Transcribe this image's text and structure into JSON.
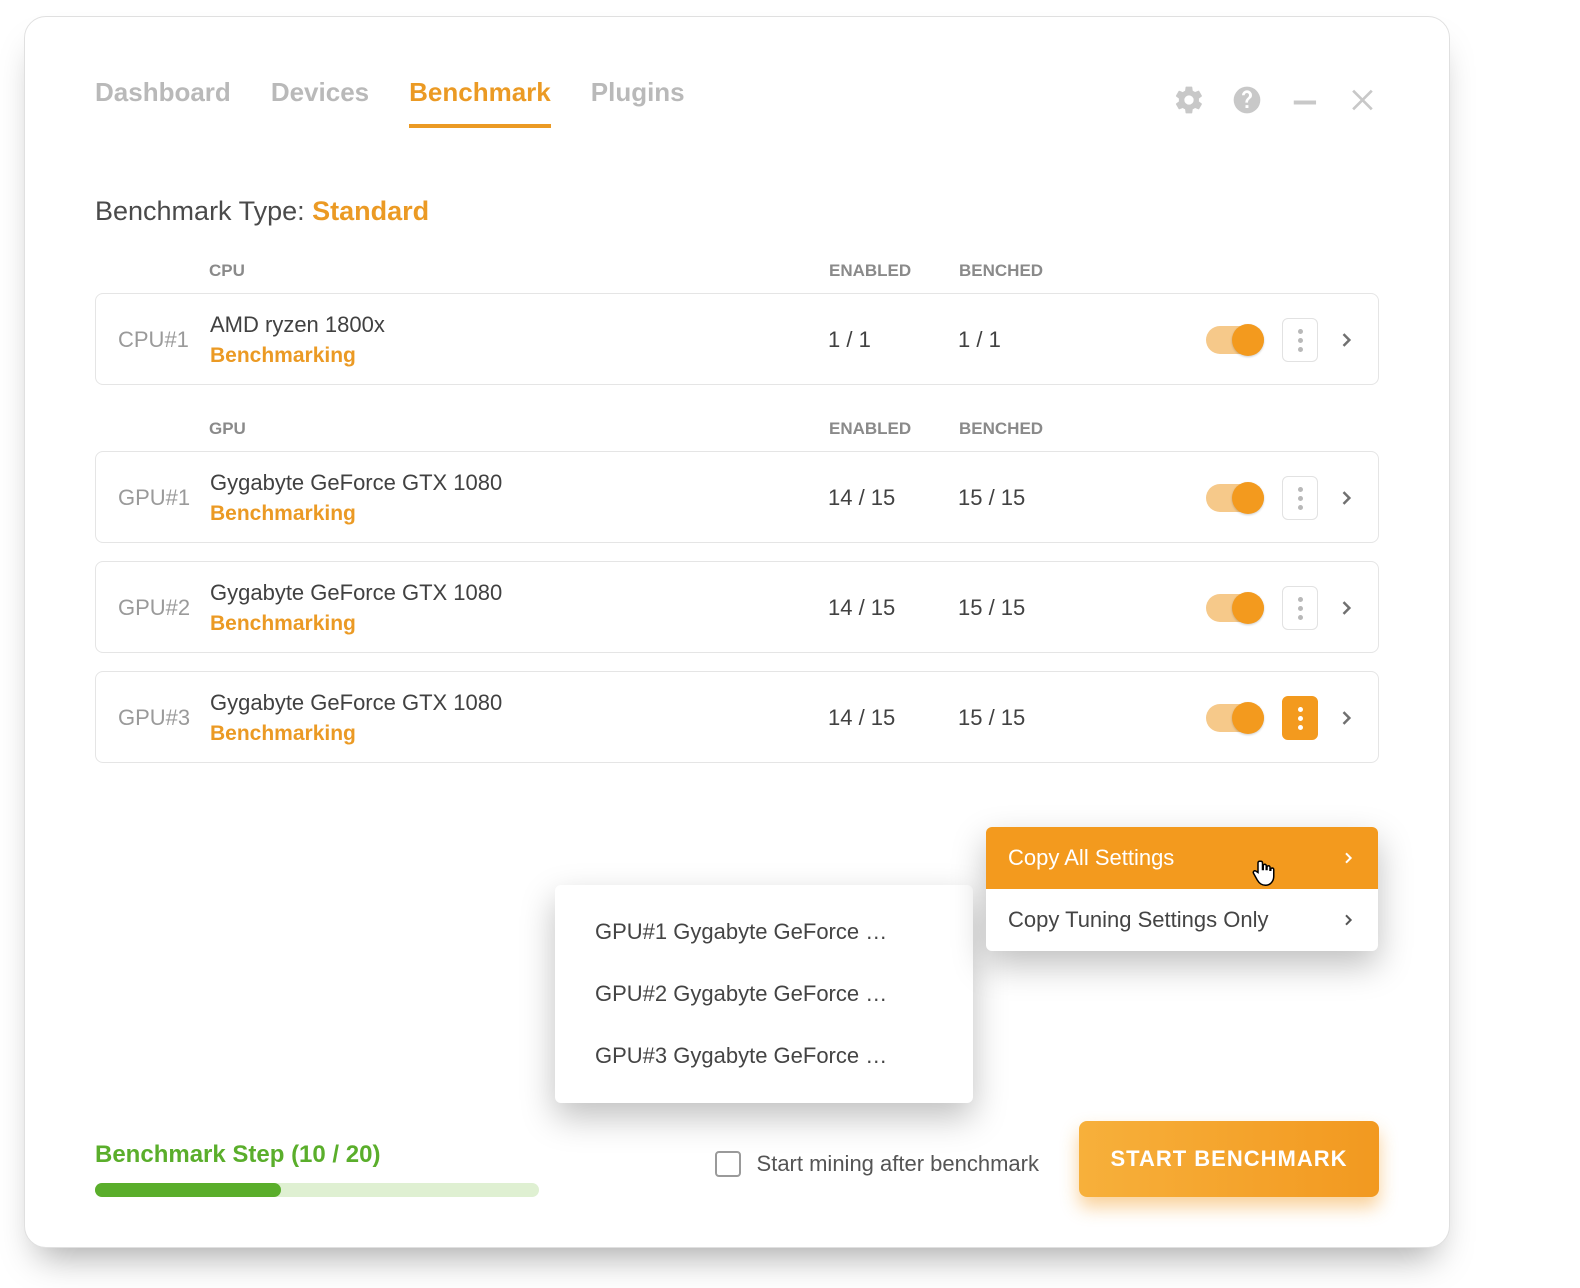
{
  "nav": {
    "tabs": [
      "Dashboard",
      "Devices",
      "Benchmark",
      "Plugins"
    ],
    "active_index": 2
  },
  "benchmark_type": {
    "label": "Benchmark Type:",
    "value": "Standard"
  },
  "columns": {
    "enabled": "ENABLED",
    "benched": "BENCHED"
  },
  "sections": [
    {
      "heading": "CPU",
      "devices": [
        {
          "id": "CPU#1",
          "name": "AMD ryzen 1800x",
          "status": "Benchmarking",
          "enabled": "1 / 1",
          "benched": "1 / 1",
          "toggle_on": true,
          "kebab_active": false
        }
      ]
    },
    {
      "heading": "GPU",
      "devices": [
        {
          "id": "GPU#1",
          "name": "Gygabyte GeForce GTX 1080",
          "status": "Benchmarking",
          "enabled": "14 / 15",
          "benched": "15 / 15",
          "toggle_on": true,
          "kebab_active": false
        },
        {
          "id": "GPU#2",
          "name": "Gygabyte GeForce GTX 1080",
          "status": "Benchmarking",
          "enabled": "14 / 15",
          "benched": "15 / 15",
          "toggle_on": true,
          "kebab_active": false
        },
        {
          "id": "GPU#3",
          "name": "Gygabyte GeForce GTX 1080",
          "status": "Benchmarking",
          "enabled": "14 / 15",
          "benched": "15 / 15",
          "toggle_on": true,
          "kebab_active": true
        }
      ]
    }
  ],
  "copy_menu": {
    "items": [
      {
        "label": "Copy All Settings",
        "highlighted": true
      },
      {
        "label": "Copy Tuning Settings Only",
        "highlighted": false
      }
    ]
  },
  "copy_target_menu": {
    "items": [
      "GPU#1 Gygabyte GeForce …",
      "GPU#2 Gygabyte GeForce …",
      "GPU#3 Gygabyte GeForce …"
    ]
  },
  "progress": {
    "label": "Benchmark Step (10 / 20)",
    "current": 10,
    "total": 20,
    "percent": 42
  },
  "start_mining_checkbox": {
    "label": "Start mining after benchmark",
    "checked": false
  },
  "start_button": "START BENCHMARK"
}
